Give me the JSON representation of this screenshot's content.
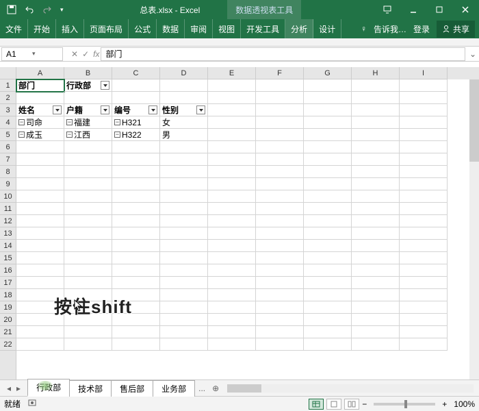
{
  "title": "总表.xlsx - Excel",
  "context_tools": "数据透视表工具",
  "ribbon": {
    "tabs": [
      "文件",
      "开始",
      "插入",
      "页面布局",
      "公式",
      "数据",
      "审阅",
      "视图",
      "开发工具"
    ],
    "ctx_tabs": [
      "分析",
      "设计"
    ],
    "tell_me": "告诉我…",
    "login": "登录",
    "share": "共享"
  },
  "namebox": "A1",
  "formula": "部门",
  "columns": [
    "A",
    "B",
    "C",
    "D",
    "E",
    "F",
    "G",
    "H",
    "I"
  ],
  "rows_count": 22,
  "pivot": {
    "r1": {
      "a": "部门",
      "b": "行政部"
    },
    "r3": {
      "a": "姓名",
      "b": "户籍",
      "c": "编号",
      "d": "性别"
    },
    "r4": {
      "a": "司命",
      "b": "福建",
      "c": "H321",
      "d": "女"
    },
    "r5": {
      "a": "成玉",
      "b": "江西",
      "c": "H322",
      "d": "男"
    }
  },
  "overlay": "按住shift",
  "sheets": [
    "行政部",
    "技术部",
    "售后部",
    "业务部"
  ],
  "tab_more": "...",
  "status": {
    "ready": "就绪",
    "zoom": "100%"
  },
  "zoom_controls": {
    "minus": "−",
    "plus": "+"
  }
}
